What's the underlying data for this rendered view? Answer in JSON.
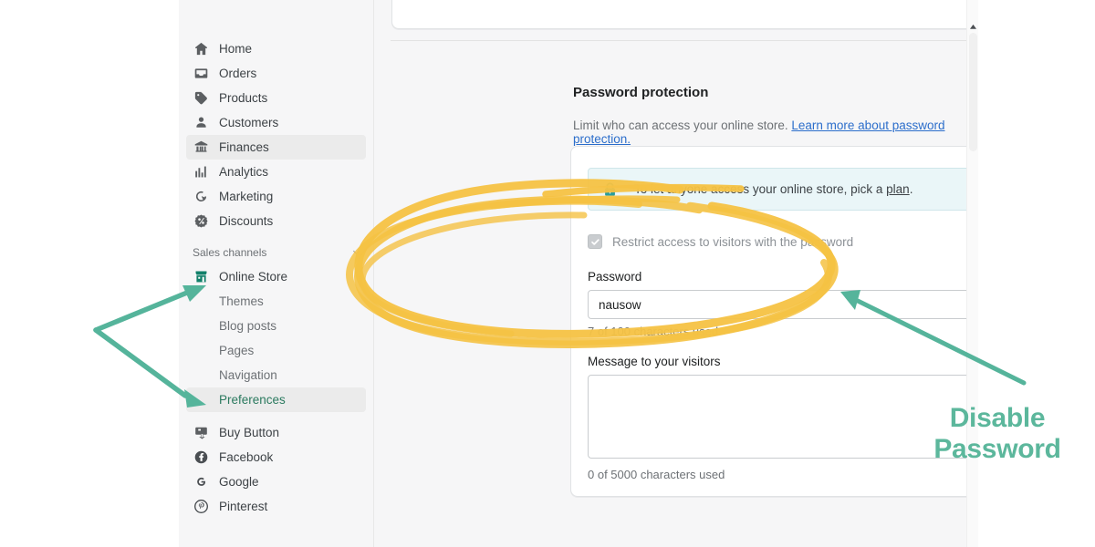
{
  "sidebar": {
    "main_items": [
      {
        "label": "Home",
        "icon": "home-icon",
        "active": false
      },
      {
        "label": "Orders",
        "icon": "orders-inbox-icon",
        "active": false
      },
      {
        "label": "Products",
        "icon": "products-tag-icon",
        "active": false
      },
      {
        "label": "Customers",
        "icon": "customers-person-icon",
        "active": false
      },
      {
        "label": "Finances",
        "icon": "finances-bank-icon",
        "active": true
      },
      {
        "label": "Analytics",
        "icon": "analytics-bars-icon",
        "active": false
      },
      {
        "label": "Marketing",
        "icon": "marketing-target-icon",
        "active": false
      },
      {
        "label": "Discounts",
        "icon": "discounts-percent-icon",
        "active": false
      }
    ],
    "section_header": "Sales channels",
    "channel_items": [
      {
        "label": "Online Store",
        "icon": "online-store-icon",
        "active": false
      },
      {
        "label": "Buy Button",
        "icon": "buy-button-icon",
        "active": false
      },
      {
        "label": "Facebook",
        "icon": "facebook-icon",
        "active": false
      },
      {
        "label": "Google",
        "icon": "google-icon",
        "active": false
      },
      {
        "label": "Pinterest",
        "icon": "pinterest-icon",
        "active": false
      }
    ],
    "online_store_subitems": [
      {
        "label": "Themes",
        "active": false
      },
      {
        "label": "Blog posts",
        "active": false
      },
      {
        "label": "Pages",
        "active": false
      },
      {
        "label": "Navigation",
        "active": false
      },
      {
        "label": "Preferences",
        "active": true
      }
    ]
  },
  "main": {
    "section_title": "Password protection",
    "description_text": "Limit who can access your online store.",
    "description_link": "Learn more about password protection.",
    "banner": {
      "icon": "lock-icon",
      "text_before": "To let anyone access your online store, pick a",
      "link": "plan",
      "text_after": "."
    },
    "restrict_checkbox": {
      "label": "Restrict access to visitors with the password",
      "checked": true,
      "disabled": true
    },
    "password_field": {
      "label": "Password",
      "value": "nausow",
      "counter": "7 of 100 characters used"
    },
    "message_field": {
      "label": "Message to your visitors",
      "value": "",
      "counter": "0 of 5000 characters used"
    }
  },
  "annotations": {
    "callout_label_line1": "Disable",
    "callout_label_line2": "Password",
    "highlight_color": "#f5c243",
    "arrow_color": "#55b49b",
    "callout_text_color": "#5cb79c"
  }
}
